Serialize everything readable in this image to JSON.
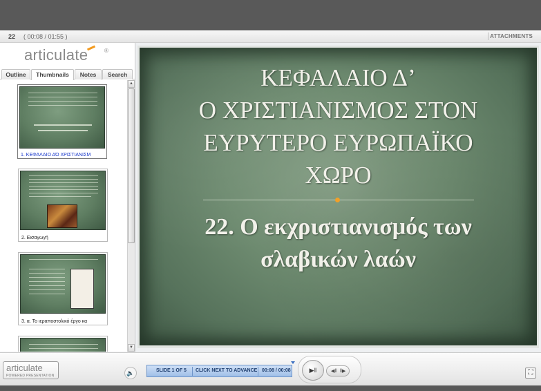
{
  "header": {
    "slide_number": "22",
    "time_display": "( 00:08 / 01:55 )",
    "attachments_label": "ATTACHMENTS"
  },
  "sidebar": {
    "logo_text": "articulate",
    "logo_mark": "®",
    "tabs": [
      {
        "label": "Outline"
      },
      {
        "label": "Thumbnails"
      },
      {
        "label": "Notes"
      },
      {
        "label": "Search"
      }
    ],
    "active_tab": "Thumbnails",
    "thumbnails": [
      {
        "caption": "1. ΚΕΦΑΛΑΙΟ ΔΌ ΧΡΙΣΤΙΑΝΙΣΜ",
        "selected": true
      },
      {
        "caption": "2. Εισαγωγή",
        "selected": false
      },
      {
        "caption": "3. α. Το ιεραποστολικό έργο κα",
        "selected": false
      },
      {
        "caption": "",
        "selected": false
      }
    ]
  },
  "slide": {
    "title_lines": [
      "ΚΕΦΑΛΑΙΟ Δ’",
      "Ο ΧΡΙΣΤΙΑΝΙΣΜΟΣ ΣΤΟΝ",
      "ΕΥΡΥΤΕΡΟ ΕΥΡΩΠΑΪΚΟ",
      "ΧΩΡΟ"
    ],
    "subtitle_lines": [
      "22. Ο εκχριστιανισμός των",
      "σλαβικών λαών"
    ],
    "accent_color": "#f0a02a"
  },
  "footer": {
    "logo_text": "articulate",
    "logo_subtext": "POWERED PRESENTATION",
    "slide_counter": "SLIDE 1 OF 5",
    "status_text": "CLICK NEXT TO ADVANCE",
    "elapsed": "00:08 / 00:08",
    "play_glyph": "▶‖",
    "prev_glyph": "◀‖",
    "next_glyph": "‖▶",
    "volume_glyph": "🔈",
    "fullscreen_glyph": "⛶",
    "progress_color": "#9fbfe8"
  }
}
